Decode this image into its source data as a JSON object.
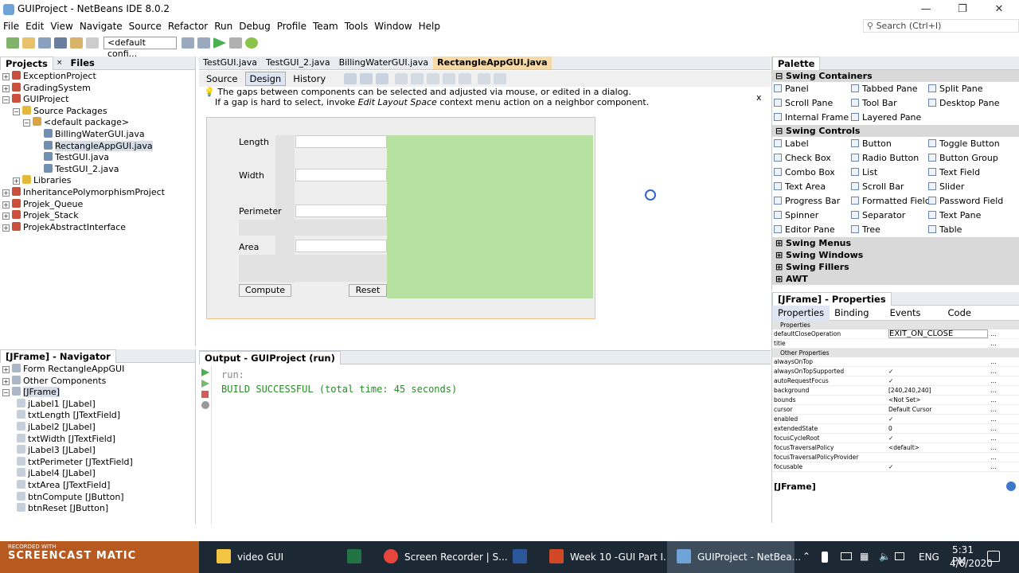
{
  "window": {
    "title": "GUIProject - NetBeans IDE 8.0.2",
    "minimize": "—",
    "restore": "❐",
    "close": "✕"
  },
  "menu": [
    "File",
    "Edit",
    "View",
    "Navigate",
    "Source",
    "Refactor",
    "Run",
    "Debug",
    "Profile",
    "Team",
    "Tools",
    "Window",
    "Help"
  ],
  "search": {
    "placeholder": "Search (Ctrl+I)"
  },
  "toolbar": {
    "config": "<default confi..."
  },
  "projects_panel": {
    "tabs": [
      "Projects",
      "Files"
    ],
    "tree": [
      {
        "label": "ExceptionProject",
        "indent": 0,
        "type": "project"
      },
      {
        "label": "GradingSystem",
        "indent": 0,
        "type": "project"
      },
      {
        "label": "GUIProject",
        "indent": 0,
        "type": "project",
        "open": true
      },
      {
        "label": "Source Packages",
        "indent": 1,
        "type": "folder",
        "open": true
      },
      {
        "label": "<default package>",
        "indent": 2,
        "type": "package",
        "open": true
      },
      {
        "label": "BillingWaterGUI.java",
        "indent": 3,
        "type": "file"
      },
      {
        "label": "RectangleAppGUI.java",
        "indent": 3,
        "type": "file",
        "selected": true
      },
      {
        "label": "TestGUI.java",
        "indent": 3,
        "type": "file"
      },
      {
        "label": "TestGUI_2.java",
        "indent": 3,
        "type": "file"
      },
      {
        "label": "Libraries",
        "indent": 1,
        "type": "folder"
      },
      {
        "label": "InheritancePolymorphismProject",
        "indent": 0,
        "type": "project"
      },
      {
        "label": "Projek_Queue",
        "indent": 0,
        "type": "project"
      },
      {
        "label": "Projek_Stack",
        "indent": 0,
        "type": "project"
      },
      {
        "label": "ProjekAbstractInterface",
        "indent": 0,
        "type": "project"
      }
    ]
  },
  "navigator": {
    "title": "[JFrame] - Navigator",
    "tree": [
      {
        "label": "Form RectangleAppGUI",
        "indent": 0
      },
      {
        "label": "Other Components",
        "indent": 0
      },
      {
        "label": "[JFrame]",
        "indent": 0,
        "selected": true
      },
      {
        "label": "jLabel1 [JLabel]",
        "indent": 1
      },
      {
        "label": "txtLength [JTextField]",
        "indent": 1
      },
      {
        "label": "jLabel2 [JLabel]",
        "indent": 1
      },
      {
        "label": "txtWidth [JTextField]",
        "indent": 1
      },
      {
        "label": "jLabel3 [JLabel]",
        "indent": 1
      },
      {
        "label": "txtPerimeter [JTextField]",
        "indent": 1
      },
      {
        "label": "jLabel4 [JLabel]",
        "indent": 1
      },
      {
        "label": "txtArea [JTextField]",
        "indent": 1
      },
      {
        "label": "btnCompute [JButton]",
        "indent": 1
      },
      {
        "label": "btnReset [JButton]",
        "indent": 1
      }
    ]
  },
  "editor": {
    "tabs": [
      "TestGUI.java",
      "TestGUI_2.java",
      "BillingWaterGUI.java",
      "RectangleAppGUI.java"
    ],
    "views": [
      "Source",
      "Design",
      "History"
    ],
    "hint_line1": "The gaps between components can be selected and adjusted via mouse, or edited in a dialog.",
    "hint_line2_pre": "If a gap is hard to select, invoke ",
    "hint_line2_em": "Edit Layout Space",
    "hint_line2_post": " context menu action on a neighbor component.",
    "hint_close": "x",
    "form": {
      "length": "Length",
      "width": "Width",
      "perimeter": "Perimeter",
      "area": "Area",
      "compute": "Compute",
      "reset": "Reset"
    }
  },
  "output": {
    "title": "Output - GUIProject (run)",
    "line1": "run:",
    "line2": "BUILD SUCCESSFUL (total time: 45 seconds)"
  },
  "palette": {
    "title": "Palette",
    "containers_title": "Swing Containers",
    "containers": [
      "Panel",
      "Tabbed Pane",
      "Split Pane",
      "Scroll Pane",
      "Tool Bar",
      "Desktop Pane",
      "Internal Frame",
      "Layered Pane"
    ],
    "controls_title": "Swing Controls",
    "controls": [
      "Label",
      "Button",
      "Toggle Button",
      "Check Box",
      "Radio Button",
      "Button Group",
      "Combo Box",
      "List",
      "Text Field",
      "Text Area",
      "Scroll Bar",
      "Slider",
      "Progress Bar",
      "Formatted Field",
      "Password Field",
      "Spinner",
      "Separator",
      "Text Pane",
      "Editor Pane",
      "Tree",
      "Table"
    ],
    "collapsed": [
      "Swing Menus",
      "Swing Windows",
      "Swing Fillers",
      "AWT"
    ]
  },
  "properties": {
    "title": "[JFrame] - Properties",
    "tabs": [
      "Properties",
      "Binding",
      "Events",
      "Code"
    ],
    "section1": "Properties",
    "rows1": [
      {
        "name": "defaultCloseOperation",
        "value": "EXIT_ON_CLOSE"
      },
      {
        "name": "title",
        "value": ""
      }
    ],
    "section2": "Other Properties",
    "rows2": [
      {
        "name": "alwaysOnTop",
        "value": ""
      },
      {
        "name": "alwaysOnTopSupported",
        "value": "✓"
      },
      {
        "name": "autoRequestFocus",
        "value": "✓"
      },
      {
        "name": "background",
        "value": "[240,240,240]"
      },
      {
        "name": "bounds",
        "value": "<Not Set>"
      },
      {
        "name": "cursor",
        "value": "Default Cursor"
      },
      {
        "name": "enabled",
        "value": "✓"
      },
      {
        "name": "extendedState",
        "value": "0"
      },
      {
        "name": "focusCycleRoot",
        "value": "✓"
      },
      {
        "name": "focusTraversalPolicy",
        "value": "<default>"
      },
      {
        "name": "focusTraversalPolicyProvider",
        "value": ""
      },
      {
        "name": "focusable",
        "value": "✓"
      }
    ],
    "footer": "[JFrame]"
  },
  "taskbar": {
    "recorded": "RECORDED WITH",
    "brand": "SCREENCAST MATIC",
    "items": [
      "video GUI",
      "Screen Recorder | S...",
      "Week 10 -GUI Part I...",
      "GUIProject - NetBea..."
    ],
    "lang": "ENG",
    "time": "5:31 PM",
    "date": "4/6/2020"
  }
}
